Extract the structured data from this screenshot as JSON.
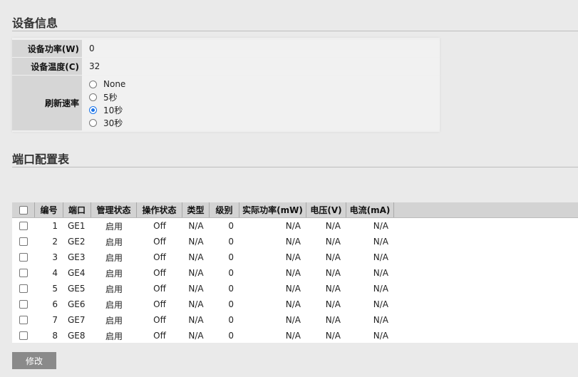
{
  "device_info": {
    "title": "设备信息",
    "power_label": "设备功率(W)",
    "power_value": "0",
    "temp_label": "设备温度(C)",
    "temp_value": "32",
    "refresh_label": "刷新速率",
    "refresh_options": [
      "None",
      "5秒",
      "10秒",
      "30秒"
    ],
    "refresh_selected": "10秒"
  },
  "port_config": {
    "title": "端口配置表",
    "columns": [
      "编号",
      "端口",
      "管理状态",
      "操作状态",
      "类型",
      "级别",
      "实际功率(mW)",
      "电压(V)",
      "电流(mA)"
    ],
    "rows": [
      {
        "id": "1",
        "port": "GE1",
        "admin": "启用",
        "oper": "Off",
        "type": "N/A",
        "level": "0",
        "power": "N/A",
        "voltage": "N/A",
        "current": "N/A"
      },
      {
        "id": "2",
        "port": "GE2",
        "admin": "启用",
        "oper": "Off",
        "type": "N/A",
        "level": "0",
        "power": "N/A",
        "voltage": "N/A",
        "current": "N/A"
      },
      {
        "id": "3",
        "port": "GE3",
        "admin": "启用",
        "oper": "Off",
        "type": "N/A",
        "level": "0",
        "power": "N/A",
        "voltage": "N/A",
        "current": "N/A"
      },
      {
        "id": "4",
        "port": "GE4",
        "admin": "启用",
        "oper": "Off",
        "type": "N/A",
        "level": "0",
        "power": "N/A",
        "voltage": "N/A",
        "current": "N/A"
      },
      {
        "id": "5",
        "port": "GE5",
        "admin": "启用",
        "oper": "Off",
        "type": "N/A",
        "level": "0",
        "power": "N/A",
        "voltage": "N/A",
        "current": "N/A"
      },
      {
        "id": "6",
        "port": "GE6",
        "admin": "启用",
        "oper": "Off",
        "type": "N/A",
        "level": "0",
        "power": "N/A",
        "voltage": "N/A",
        "current": "N/A"
      },
      {
        "id": "7",
        "port": "GE7",
        "admin": "启用",
        "oper": "Off",
        "type": "N/A",
        "level": "0",
        "power": "N/A",
        "voltage": "N/A",
        "current": "N/A"
      },
      {
        "id": "8",
        "port": "GE8",
        "admin": "启用",
        "oper": "Off",
        "type": "N/A",
        "level": "0",
        "power": "N/A",
        "voltage": "N/A",
        "current": "N/A"
      }
    ]
  },
  "actions": {
    "modify_label": "修改"
  },
  "colors": {
    "background": "#eaeaea",
    "label_bg": "#d6d6d6",
    "header_bg": "#d3d3d3",
    "radio_selected": "#1a73e8",
    "button_bg": "#8a8a8a"
  }
}
